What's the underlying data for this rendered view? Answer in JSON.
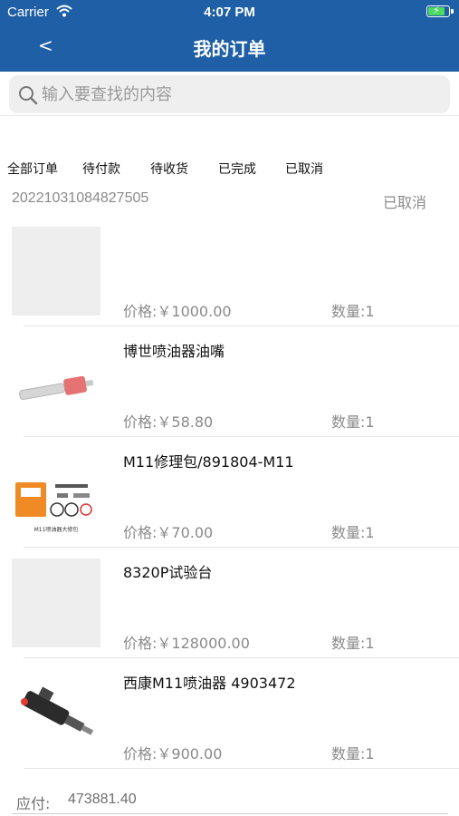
{
  "status_bar": {
    "carrier": "Carrier",
    "time": "4:07 PM"
  },
  "header": {
    "back": "<",
    "title": "我的订单"
  },
  "search": {
    "placeholder": "输入要查找的内容"
  },
  "tabs": [
    "全部订单",
    "待付款",
    "待收货",
    "已完成",
    "已取消"
  ],
  "order": {
    "number": "20221031084827505",
    "status": "已取消"
  },
  "items": [
    {
      "name": "",
      "price": "价格:￥1000.00",
      "qty": "数量:1",
      "image": "placeholder"
    },
    {
      "name": "博世喷油器油嘴",
      "price": "价格:￥58.80",
      "qty": "数量:1",
      "image": "nozzle-photo"
    },
    {
      "name": "M11修理包/891804-M11",
      "price": "价格:￥70.00",
      "qty": "数量:1",
      "image": "repair-kit-photo",
      "image_caption": "M11喷油器大修包"
    },
    {
      "name": "8320P试验台",
      "price": "价格:￥128000.00",
      "qty": "数量:1",
      "image": "placeholder"
    },
    {
      "name": "西康M11喷油器 4903472",
      "price": "价格:￥900.00",
      "qty": "数量:1",
      "image": "injector-photo"
    }
  ],
  "footer": {
    "label": "应付:",
    "amount": "473881.40"
  },
  "colors": {
    "header_bg": "#1f5fa6",
    "battery": "#4cd964",
    "muted_text": "#8a8a8a"
  }
}
